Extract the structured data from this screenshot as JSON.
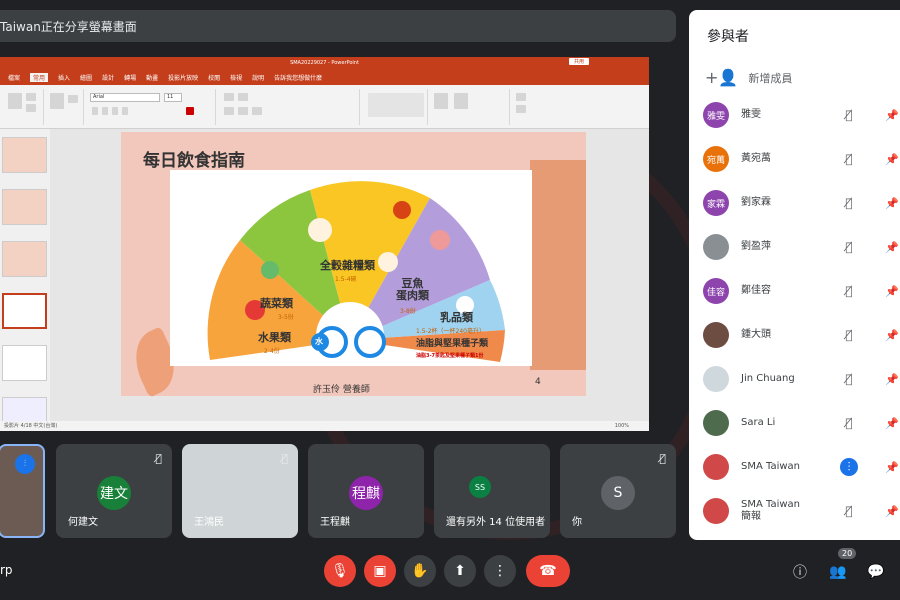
{
  "banner": {
    "text": "Taiwan正在分享螢幕畫面"
  },
  "powerpoint": {
    "window_title": "SMA20229027 - PowerPoint",
    "menu_items": [
      "檔案",
      "常用",
      "插入",
      "繪圖",
      "設計",
      "轉場",
      "動畫",
      "投影片放映",
      "校閱",
      "檢視",
      "說明",
      "告訴我您想做什麼"
    ],
    "font_name": "Arial",
    "font_size": "11",
    "status_text": "投影片 4/18  中文(台灣)",
    "zoom": "100%",
    "share_btn": "共用"
  },
  "slide": {
    "title": "每日飲食指南",
    "footer": "許玉伶 營養師",
    "page_number": "4",
    "labels": {
      "grains": "全穀雜糧類",
      "grains_sub": "1.5-4碗",
      "vegetables": "蔬菜類",
      "vegetables_sub": "3-5份",
      "fruits": "水果類",
      "fruits_sub": "2-4份",
      "protein": "豆魚\n蛋肉類",
      "protein_sub": "3-8份",
      "dairy": "乳品類",
      "dairy_sub": "1.5-2杯（一杯240毫升）",
      "oils": "油脂與堅果種子類",
      "oils_sub": "油脂3-7茶匙及堅果種子類1份",
      "water": "水"
    }
  },
  "participants_panel": {
    "title": "參與者",
    "add_label": "新增成員",
    "participants": [
      {
        "initials": "雅雯",
        "name": "雅雯",
        "color": "#8e44ad",
        "mic": "off"
      },
      {
        "initials": "宛萬",
        "name": "黃宛萬",
        "color": "#e8710a",
        "mic": "off"
      },
      {
        "initials": "家霖",
        "name": "劉家霖",
        "color": "#8e44ad",
        "mic": "off"
      },
      {
        "initials": "",
        "name": "劉盈萍",
        "color": "#8a8f94",
        "mic": "off"
      },
      {
        "initials": "佳容",
        "name": "鄭佳容",
        "color": "#8e44ad",
        "mic": "off"
      },
      {
        "initials": "",
        "name": "鍾大頭",
        "color": "#6d4c41",
        "mic": "off"
      },
      {
        "initials": "",
        "name": "Jin Chuang",
        "color": "#cfd8dc",
        "mic": "off"
      },
      {
        "initials": "",
        "name": "Sara Li",
        "color": "#4e6b4e",
        "mic": "off"
      },
      {
        "initials": "",
        "name": "SMA Taiwan",
        "color": "#d04848",
        "mic": "active"
      },
      {
        "initials": "",
        "name": "SMA Taiwan\n簡報",
        "color": "#d04848",
        "mic": "off"
      }
    ]
  },
  "tiles": [
    {
      "name": "",
      "initials": "",
      "kind": "self"
    },
    {
      "name": "何建文",
      "initials": "建文",
      "color": "#188038"
    },
    {
      "name": "王鴻民",
      "initials": "",
      "color": ""
    },
    {
      "name": "王程麒",
      "initials": "程麒",
      "color": "#8e24aa"
    },
    {
      "name": "還有另外 14 位使用者",
      "initials": "SS",
      "color": "#0b8043"
    },
    {
      "name": "你",
      "initials": "S",
      "color": "#5f6368"
    }
  ],
  "bottom": {
    "meeting_code": "rp",
    "participant_count": "20"
  }
}
